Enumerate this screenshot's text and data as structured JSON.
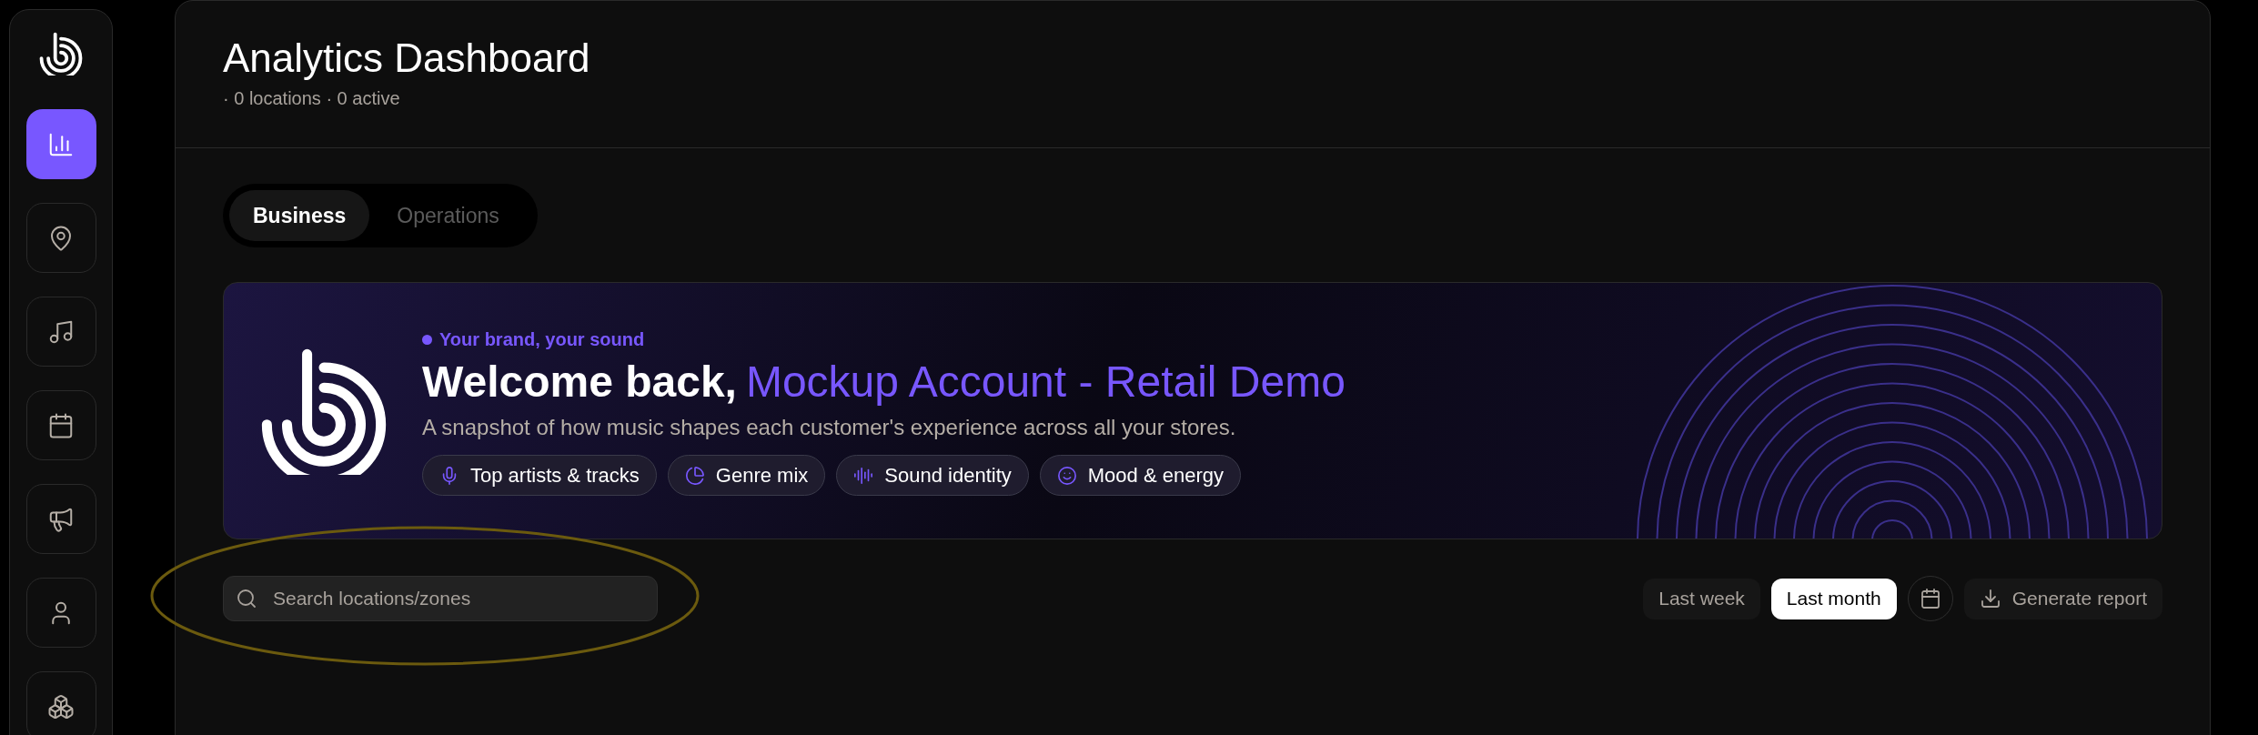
{
  "sidebar": {
    "items": [
      {
        "selected": true
      },
      {
        "selected": false
      },
      {
        "selected": false
      },
      {
        "selected": false
      },
      {
        "selected": false
      },
      {
        "selected": false
      },
      {
        "selected": false
      }
    ]
  },
  "header": {
    "title": "Analytics Dashboard",
    "subtitle": "· 0 locations · 0 active"
  },
  "tabs": [
    {
      "label": "Business",
      "selected": true
    },
    {
      "label": "Operations",
      "selected": false
    }
  ],
  "banner": {
    "tagline": "Your brand, your sound",
    "greeting": "Welcome back,",
    "account_name": "Mockup Account - Retail Demo",
    "description": "A snapshot of how music shapes each customer's experience across all your stores.",
    "chips": [
      {
        "label": "Top artists & tracks"
      },
      {
        "label": "Genre mix"
      },
      {
        "label": "Sound identity"
      },
      {
        "label": "Mood & energy"
      }
    ]
  },
  "search": {
    "placeholder": "Search locations/zones"
  },
  "periods": [
    {
      "label": "Last week",
      "selected": false
    },
    {
      "label": "Last month",
      "selected": true
    }
  ],
  "report_button": {
    "label": "Generate report"
  }
}
